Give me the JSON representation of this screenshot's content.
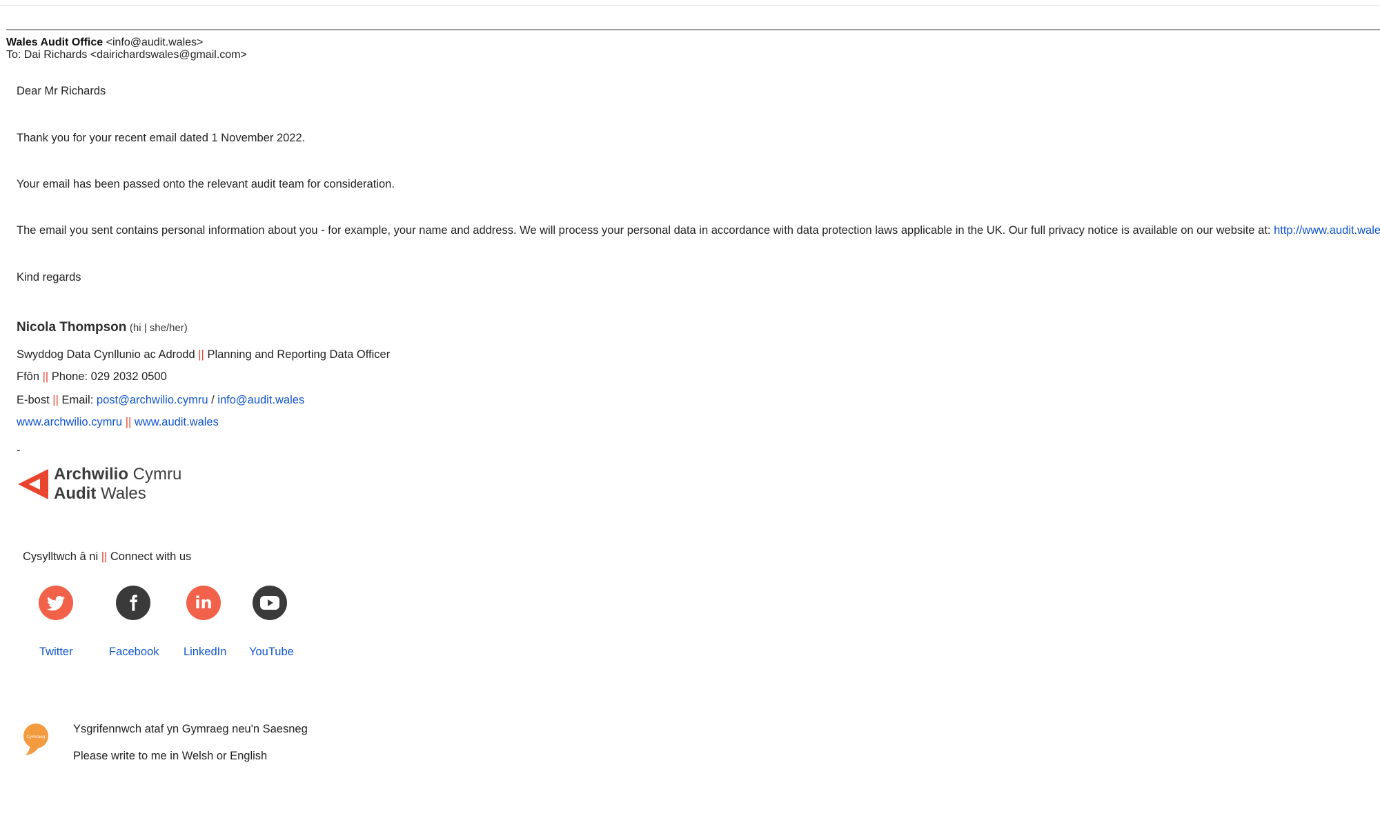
{
  "email": {
    "from_name": "Wales Audit Office",
    "from_address": "<info@audit.wales>",
    "to_line": "To: Dai Richards <dairichardswales@gmail.com>"
  },
  "body": {
    "greeting": "Dear Mr Richards",
    "para1": "Thank you for your recent email dated 1 November 2022.",
    "para2": "Your email has been passed onto the relevant audit team for consideration.",
    "para3": "The email you sent contains personal information about you - for example, your name and address. We will process your personal data in accordance with data protection laws applicable in the UK. Our full privacy notice is available on our website at: ",
    "privacy_link": "http://www.audit.wales",
    "closing": "Kind regards"
  },
  "signature": {
    "name": "Nicola Thompson",
    "pronouns": "(hi | she/her)",
    "title_cy": "Swyddog Data Cynllunio ac Adrodd",
    "separator": "||",
    "title_en": "Planning and Reporting Data Officer",
    "phone_label_cy": "Ffôn",
    "phone_label_en": "Phone: 029 2032 0500",
    "email_label_cy": "E-bost",
    "email_label_en": "Email:",
    "email_1": "post@archwilio.cymru",
    "email_slash": "/",
    "email_2": "info@audit.wales",
    "web_1": "www.archwilio.cymru",
    "web_2": "www.audit.wales",
    "dash": "-"
  },
  "logo": {
    "line1_bold": "Archwilio",
    "line1_rest": " Cymru",
    "line2_bold": "Audit",
    "line2_rest": " Wales",
    "accent_color": "#e8442e"
  },
  "connect": {
    "label_cy": "Cysylltwch â ni",
    "label_en": "Connect with us",
    "items": [
      {
        "label": "Twitter",
        "icon": "twitter-icon",
        "color": "#f26149"
      },
      {
        "label": "Facebook",
        "icon": "facebook-icon",
        "color": "#3a3a3a"
      },
      {
        "label": "LinkedIn",
        "icon": "linkedin-icon",
        "color": "#f26149"
      },
      {
        "label": "YouTube",
        "icon": "youtube-icon",
        "color": "#3a3a3a"
      }
    ]
  },
  "welsh_note": {
    "icon_label": "Cymraeg",
    "line_cy": "Ysgrifennwch ataf yn Gymraeg neu'n Saesneg",
    "line_en": "Please write to me in Welsh or English",
    "icon_color": "#f49b3f"
  }
}
